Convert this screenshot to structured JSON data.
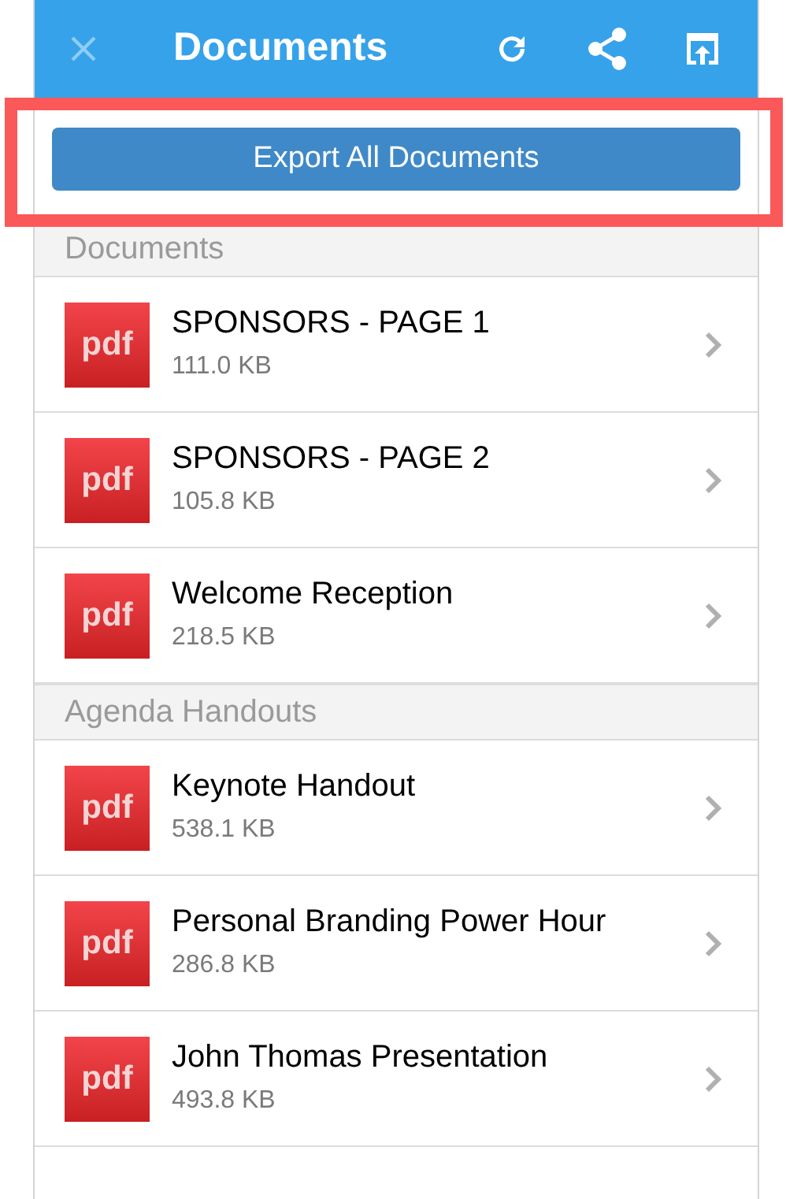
{
  "header": {
    "title": "Documents"
  },
  "export_button": {
    "label": "Export All Documents"
  },
  "highlight": {
    "kind": "annotation-frame"
  },
  "sections": [
    {
      "title": "Documents",
      "items": [
        {
          "icon_label": "pdf",
          "name": "SPONSORS - PAGE 1",
          "size": "111.0 KB"
        },
        {
          "icon_label": "pdf",
          "name": "SPONSORS - PAGE 2",
          "size": "105.8 KB"
        },
        {
          "icon_label": "pdf",
          "name": "Welcome Reception",
          "size": "218.5 KB"
        }
      ]
    },
    {
      "title": "Agenda Handouts",
      "items": [
        {
          "icon_label": "pdf",
          "name": "Keynote Handout",
          "size": "538.1 KB"
        },
        {
          "icon_label": "pdf",
          "name": "Personal Branding Power Hour",
          "size": "286.8 KB"
        },
        {
          "icon_label": "pdf",
          "name": "John Thomas Presentation",
          "size": "493.8 KB"
        }
      ]
    }
  ]
}
